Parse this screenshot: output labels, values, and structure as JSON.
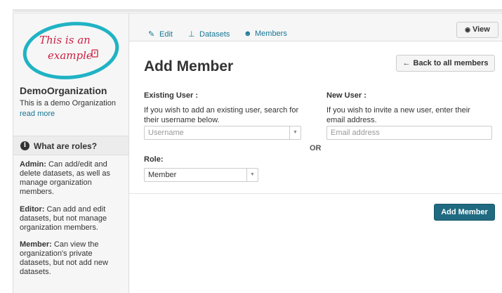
{
  "logo": {
    "text_line1": "This is an",
    "text_line2": "example",
    "accent": "#1fb3c4",
    "ink": "#cc2244"
  },
  "sidebar": {
    "org_name": "DemoOrganization",
    "org_desc": "This is a demo Organization",
    "read_more": "read more",
    "roles_header": "What are roles?",
    "roles_icon": "info-icon",
    "roles": [
      {
        "name": "Admin:",
        "desc_lines": [
          "Can add/edit and",
          "delete datasets, as well as",
          "manage organization",
          "members."
        ]
      },
      {
        "name": "Editor:",
        "desc_lines": [
          "Can add and edit",
          "datasets, but not manage",
          "organization members."
        ]
      },
      {
        "name": "Member:",
        "desc_lines": [
          "Can view the",
          "organization's private",
          "datasets, but not add new",
          "datasets."
        ]
      }
    ]
  },
  "nav": {
    "tabs": [
      {
        "label": "Edit",
        "icon": "edit-icon"
      },
      {
        "label": "Datasets",
        "icon": "sitemap-icon"
      },
      {
        "label": "Members",
        "icon": "group-icon"
      }
    ],
    "view_label": "View",
    "view_icon": "eye-icon"
  },
  "main": {
    "title": "Add Member",
    "back_label": "Back to all members",
    "back_icon": "arrow-left-icon",
    "existing_user": {
      "label": "Existing User :",
      "hint_line1": "If you wish to add an existing user, search for",
      "hint_line2": "their username below.",
      "placeholder": "Username"
    },
    "or_label": "OR",
    "new_user": {
      "label": "New User :",
      "hint_line1": "If you wish to invite a new user, enter their",
      "hint_line2": "email address.",
      "placeholder": "Email address"
    },
    "role": {
      "label": "Role:",
      "value": "Member"
    },
    "submit_label": "Add Member",
    "submit_color": "#206b82",
    "link_color": "#187794"
  }
}
